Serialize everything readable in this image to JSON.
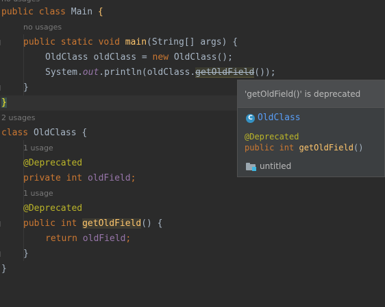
{
  "code": {
    "top_hint": "no usages",
    "line_main_class": [
      "public",
      "class",
      "Main",
      "{"
    ],
    "hint_no_usages": "no usages",
    "line_main_method": [
      "public",
      "static",
      "void",
      "main",
      "(String[] args) {"
    ],
    "line_new": [
      "OldClass oldClass = ",
      "new",
      " OldClass();"
    ],
    "line_println": [
      "System.",
      "out",
      ".println(oldClass.",
      "getOldField",
      "());"
    ],
    "close_brace_1": "}",
    "close_brace_main": "}",
    "hint_2_usages": "2 usages",
    "line_class_old": [
      "class",
      "OldClass {"
    ],
    "hint_1_usage_a": "1 usage",
    "ann_deprecated_a": "@Deprecated",
    "line_field": [
      "private",
      "int",
      "oldField",
      ";"
    ],
    "hint_1_usage_b": "1 usage",
    "ann_deprecated_b": "@Deprecated",
    "line_getter": [
      "public",
      "int",
      "getOldField",
      "() {"
    ],
    "line_return": [
      "return",
      "oldField",
      ";"
    ],
    "close_brace_getter": "}",
    "close_brace_class": "}"
  },
  "popup": {
    "header": "'getOldField()' is deprecated",
    "class_icon_letter": "C",
    "class_name": "OldClass",
    "annotation": "@Deprecated",
    "signature_keywords": "public int ",
    "signature_method": "getOldField",
    "signature_tail": "()",
    "module_name": "untitled"
  },
  "colors": {
    "background": "#2b2b2b",
    "keyword": "#cc7832",
    "method": "#ffc66d",
    "field": "#9876aa",
    "annotation": "#bbb529",
    "link": "#589df6"
  }
}
